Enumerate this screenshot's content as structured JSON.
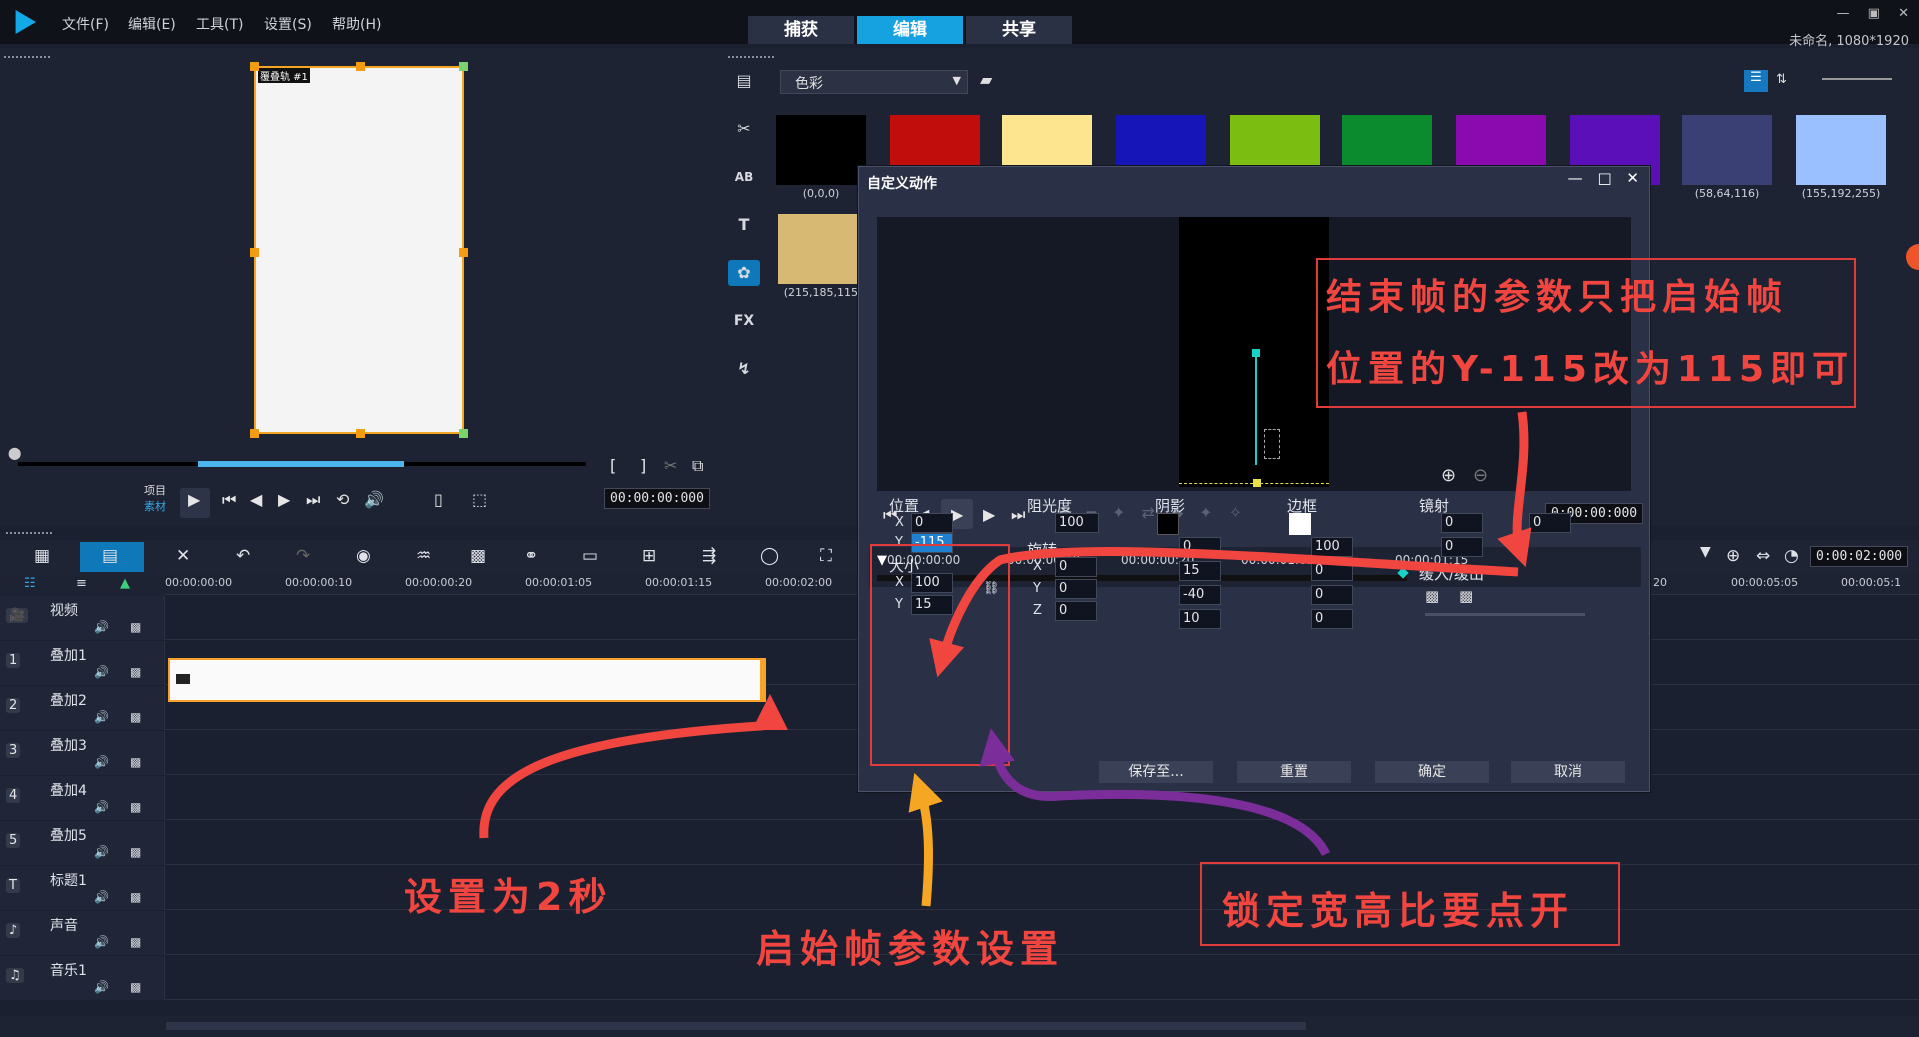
{
  "menu": [
    "文件(F)",
    "编辑(E)",
    "工具(T)",
    "设置(S)",
    "帮助(H)"
  ],
  "modes": [
    "捕获",
    "编辑",
    "共享"
  ],
  "window_controls": [
    "—",
    "▣",
    "✕"
  ],
  "project_info": "未命名, 1080*1920",
  "preview": {
    "canvas_label": "覆叠轨 #1",
    "mode_project": "项目",
    "mode_clip": "素材",
    "timecode": "00:00:00:000"
  },
  "library": {
    "dropdown": "色彩",
    "swatches": [
      {
        "color": "#000000",
        "caption": "(0,0,0)"
      },
      {
        "color": "#c20d0d",
        "caption": ""
      },
      {
        "color": "#fde48f",
        "caption": ""
      },
      {
        "color": "#1515b8",
        "caption": ""
      },
      {
        "color": "#7cbd12",
        "caption": ""
      },
      {
        "color": "#0c8a2e",
        "caption": ""
      },
      {
        "color": "#8a0ab0",
        "caption": ""
      },
      {
        "color": "#5a0fb8",
        "caption": ""
      },
      {
        "color": "#3a4074",
        "caption": "(58,64,116)"
      },
      {
        "color": "#9bc0ff",
        "caption": "(155,192,255)"
      },
      {
        "color": "#d7b973",
        "caption": "(215,185,115)"
      }
    ],
    "side_tools": [
      "▤",
      "✂",
      "AB",
      "T",
      "✿",
      "FX",
      "↯"
    ]
  },
  "timeline": {
    "ruler_ticks": [
      "00:00:00:00",
      "00:00:00:10",
      "00:00:00:20",
      "00:00:01:05",
      "00:00:01:15",
      "00:00:02:00"
    ],
    "right_ticks": [
      "20",
      "00:00:05:05",
      "00:00:05:1"
    ],
    "right_timecode": "0:00:02:000",
    "tracks": [
      {
        "name": "视频",
        "icon": "🎥"
      },
      {
        "name": "叠加1",
        "icon": "1"
      },
      {
        "name": "叠加2",
        "icon": "2"
      },
      {
        "name": "叠加3",
        "icon": "3"
      },
      {
        "name": "叠加4",
        "icon": "4"
      },
      {
        "name": "叠加5",
        "icon": "5"
      },
      {
        "name": "标题1",
        "icon": "T"
      },
      {
        "name": "声音",
        "icon": "♪"
      },
      {
        "name": "音乐1",
        "icon": "♫"
      }
    ]
  },
  "dialog": {
    "title": "自定义动作",
    "timecode": "0:00:00:000",
    "ticks": [
      "00:00:00:00",
      "00:00:00:10",
      "00:00:00:20",
      "00:00:01:05",
      "00:00:01:15"
    ],
    "position": {
      "label": "位置",
      "x": "0",
      "y": "-115"
    },
    "size": {
      "label": "大小",
      "x": "100",
      "y": "15"
    },
    "opacity": {
      "label": "阻光度",
      "value": "100"
    },
    "rotation": {
      "label": "旋转",
      "x": "0",
      "y": "0",
      "z": "0"
    },
    "shadow": {
      "label": "阴影",
      "v1": "0",
      "v2": "15",
      "v3": "-40",
      "v4": "10"
    },
    "border": {
      "label": "边框",
      "v1": "100",
      "v2": "0",
      "v3": "0",
      "v4": "0"
    },
    "mirror": {
      "label": "镜射",
      "v1": "0",
      "v2": "0",
      "v3": "0"
    },
    "ease": {
      "label": "缓入/缓出"
    },
    "buttons": [
      "保存至...",
      "重置",
      "确定",
      "取消"
    ]
  },
  "annotations": {
    "end_frame_line1": "结束帧的参数只把启始帧",
    "end_frame_line2": "位置的Y-115改为115即可",
    "set_2s": "设置为2秒",
    "start_params": "启始帧参数设置",
    "unlock_ratio": "锁定宽高比要点开"
  }
}
